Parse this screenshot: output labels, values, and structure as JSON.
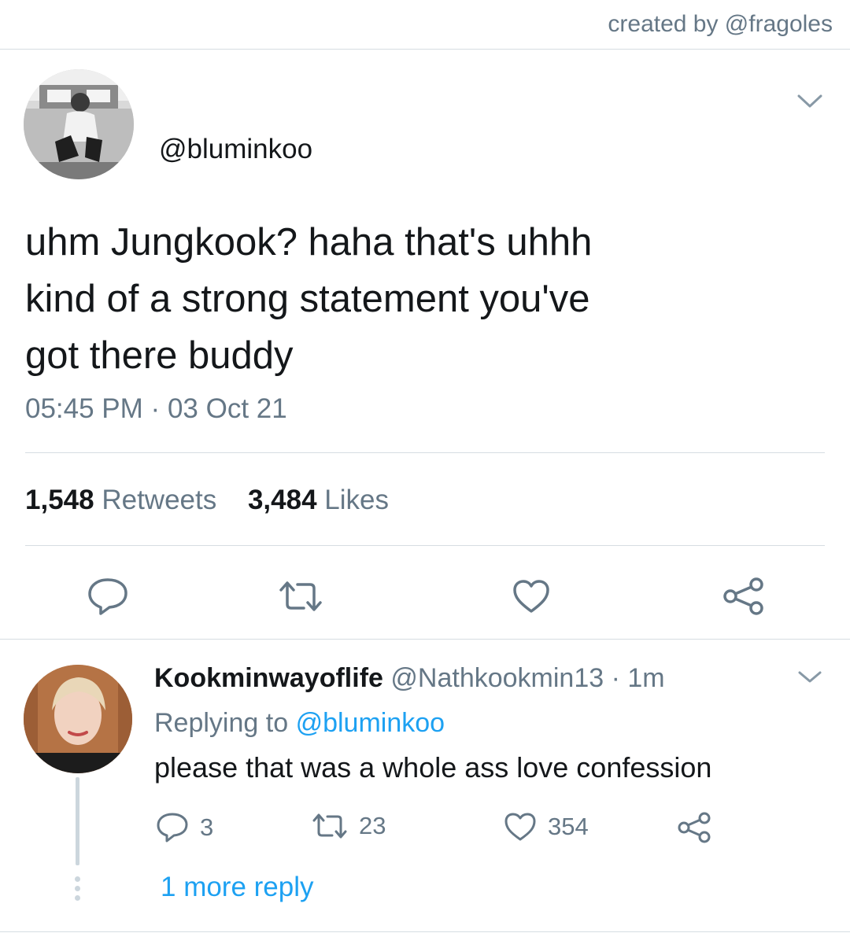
{
  "credit": "created by @fragoles",
  "tweet": {
    "handle": "@bluminkoo",
    "text_lines": [
      "uhm Jungkook? haha that's uhhh",
      "kind of a strong statement you've",
      "got there buddy"
    ],
    "time": "05:45 PM",
    "separator": "·",
    "date": "03 Oct 21",
    "retweets_count": "1,548",
    "retweets_label": "Retweets",
    "likes_count": "3,484",
    "likes_label": "Likes"
  },
  "reply": {
    "name": "Kookminwayoflife",
    "handle": "@Nathkookmin13",
    "separator": "·",
    "time": "1m",
    "replying_to_label": "Replying to",
    "replying_to_handle": "@bluminkoo",
    "text": "please that was a whole ass love confession",
    "replies": "3",
    "retweets": "23",
    "likes": "354",
    "more_replies": "1 more reply"
  },
  "icons": {
    "reply": "reply-icon",
    "retweet": "retweet-icon",
    "like": "heart-icon",
    "share": "share-icon",
    "menu": "chevron-down-icon"
  },
  "colors": {
    "accent": "#1da1f2",
    "secondary_text": "#657786",
    "primary_text": "#14171a",
    "divider": "#d6dde2"
  }
}
